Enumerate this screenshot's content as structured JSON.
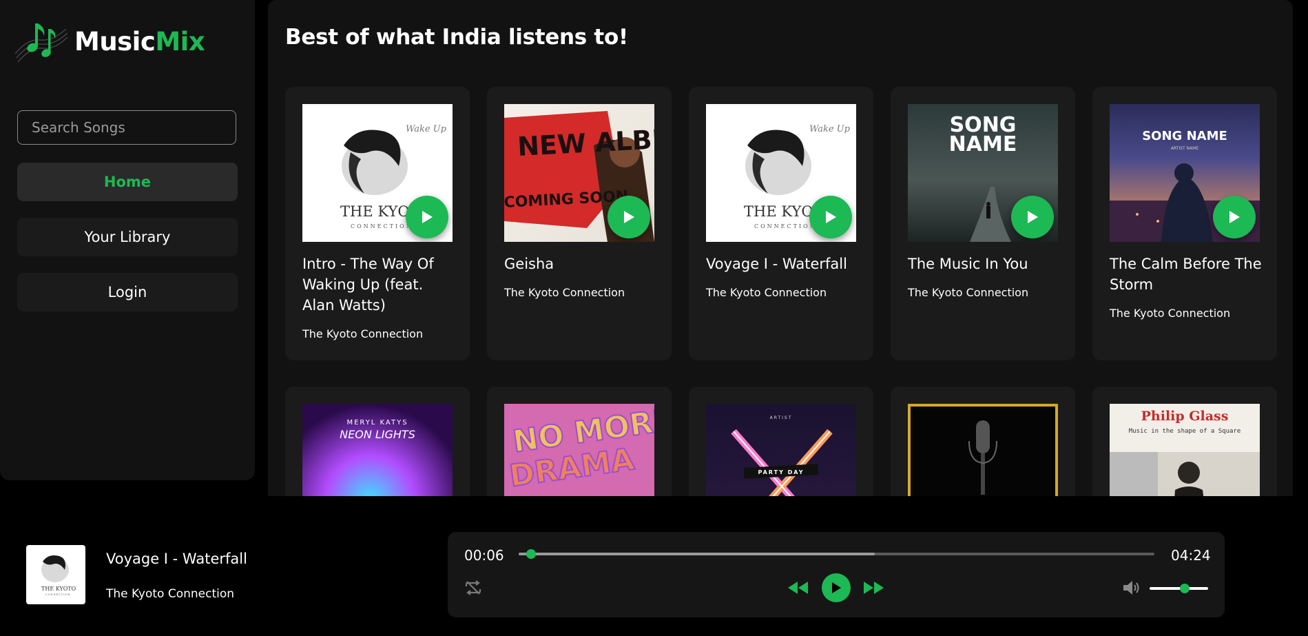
{
  "app": {
    "logo_part1": "Music",
    "logo_part2": "Mix",
    "accent_color": "#1db954"
  },
  "sidebar": {
    "search_placeholder": "Search Songs",
    "nav": [
      {
        "label": "Home",
        "active": true
      },
      {
        "label": "Your Library",
        "active": false
      },
      {
        "label": "Login",
        "active": false
      }
    ]
  },
  "main": {
    "title": "Best of what India listens to!",
    "cards": [
      {
        "title": "Intro - The Way Of Waking Up (feat. Alan Watts)",
        "artist": "The Kyoto Connection",
        "cover_text": "THE KYOTO",
        "cover_sub": "CONNECTION",
        "cover_script": "Wake Up"
      },
      {
        "title": "Geisha",
        "artist": "The Kyoto Connection",
        "cover_text": "NEW ALBUM",
        "cover_sub": "COMING SOON"
      },
      {
        "title": "Voyage I - Waterfall",
        "artist": "The Kyoto Connection",
        "cover_text": "THE KYOTO",
        "cover_sub": "CONNECTION",
        "cover_script": "Wake Up"
      },
      {
        "title": "The Music In You",
        "artist": "The Kyoto Connection",
        "cover_text": "SONG",
        "cover_sub": "NAME"
      },
      {
        "title": "The Calm Before The Storm",
        "artist": "The Kyoto Connection",
        "cover_text": "SONG NAME",
        "cover_sub": "ARTIST NAME"
      }
    ],
    "row2_covers": [
      {
        "cover_text": "MERYL KATYS",
        "cover_sub": "NEON LIGHTS"
      },
      {
        "cover_text": "NO MORE",
        "cover_sub": "DRAMA"
      },
      {
        "cover_text": "ARTIST",
        "cover_sub": "PARTY DAY"
      },
      {
        "cover_text": "",
        "cover_sub": ""
      },
      {
        "cover_text": "Philip Glass",
        "cover_sub": "Music in the shape of a Square"
      }
    ]
  },
  "player": {
    "title": "Voyage I - Waterfall",
    "artist": "The Kyoto Connection",
    "current_time": "00:06",
    "duration": "04:24",
    "progress_fraction": 0.02,
    "buffered_fraction": 0.56,
    "volume_fraction": 0.6,
    "icons": [
      "repeat-icon",
      "rewind-icon",
      "play-icon",
      "fast-forward-icon",
      "volume-icon"
    ]
  }
}
